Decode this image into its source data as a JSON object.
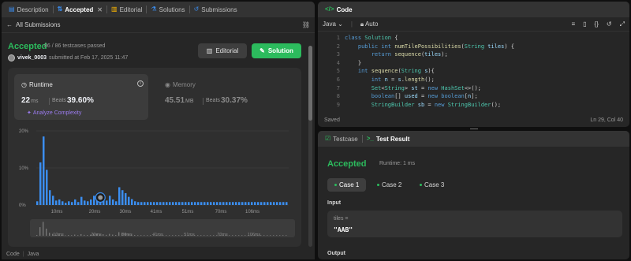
{
  "left_tabs": {
    "description": "Description",
    "accepted": "Accepted",
    "editorial": "Editorial",
    "solutions": "Solutions",
    "submissions": "Submissions"
  },
  "submission": {
    "back_label": "All Submissions",
    "status": "Accepted",
    "testcases": "86 / 86 testcases passed",
    "username": "vivek_0003",
    "submitted_at": "submitted at Feb 17, 2025 11:47",
    "editorial_btn": "Editorial",
    "solution_btn": "Solution"
  },
  "runtime": {
    "label": "Runtime",
    "value": "22",
    "unit": "ms",
    "beats_label": "Beats",
    "beats": "39.60%",
    "analyze": "Analyze Complexity"
  },
  "memory": {
    "label": "Memory",
    "value": "45.51",
    "unit": "MB",
    "beats_label": "Beats",
    "beats": "30.37%"
  },
  "chart_data": {
    "type": "bar",
    "y_ticks": [
      "20%",
      "10%",
      "0%"
    ],
    "ylim": [
      0,
      20
    ],
    "x_ticks": [
      "10ms",
      "20ms",
      "30ms",
      "41ms",
      "51ms",
      "70ms",
      "106ms"
    ],
    "values": [
      1,
      11.5,
      18.5,
      9.5,
      4,
      2.5,
      1.2,
      1.5,
      1,
      0.6,
      1,
      0.8,
      1.5,
      0.8,
      2.2,
      1.2,
      1,
      1.5,
      2.5,
      2.2,
      1.6,
      2,
      1.2,
      2.5,
      1.5,
      1,
      4.8,
      4,
      3.2,
      2.2,
      1.6,
      1,
      0.8,
      0.8,
      0.8,
      0.8,
      0.8,
      0.8,
      0.8,
      0.8,
      0.8,
      0.8,
      0.8,
      0.8,
      0.8,
      0.8,
      0.8,
      0.8,
      0.8,
      0.8,
      0.8,
      0.8,
      0.8,
      0.8,
      0.8,
      0.8,
      0.8,
      0.8,
      0.8,
      0.8,
      0.8,
      0.8,
      0.8,
      0.8,
      0.8,
      0.8,
      0.8,
      0.8,
      0.8,
      0.8,
      0.8,
      0.8,
      0.8,
      0.8,
      0.8,
      0.8,
      0.8,
      0.8,
      0.8,
      0.8
    ],
    "highlight_index": 20,
    "colors": {
      "bar": "#3b8ef0",
      "mini_bar": "#777777"
    }
  },
  "code_panel": {
    "title": "Code",
    "language": "Java",
    "autosave": "Auto",
    "status": "Saved",
    "cursor": "Ln 29, Col 40",
    "lines": [
      {
        "n": "1",
        "html": "<span class='kw'>class</span> <span class='ty'>Solution</span> {"
      },
      {
        "n": "2",
        "html": "    <span class='kw'>public</span> <span class='kw'>int</span> <span class='fn'>numTilePossibilities</span>(<span class='ty'>String</span> <span class='vr'>tiles</span>) {"
      },
      {
        "n": "3",
        "html": "        <span class='kw'>return</span> <span class='fn'>sequence</span>(<span class='vr'>tiles</span>);"
      },
      {
        "n": "4",
        "html": "    }"
      },
      {
        "n": "5",
        "html": "    <span class='kw'>int</span> <span class='fn'>sequence</span>(<span class='ty'>String</span> <span class='vr'>s</span>){"
      },
      {
        "n": "6",
        "html": "        <span class='kw'>int</span> <span class='vr'>n</span> = <span class='vr'>s</span>.<span class='fn'>length</span>();"
      },
      {
        "n": "7",
        "html": "        <span class='ty'>Set</span>&lt;<span class='ty'>String</span>&gt; <span class='vr'>st</span> = <span class='kw'>new</span> <span class='ty'>HashSet</span>&lt;&gt;();"
      },
      {
        "n": "8",
        "html": "        <span class='kw'>boolean</span>[] <span class='vr'>used</span> = <span class='kw'>new</span> <span class='kw'>boolean</span>[<span class='vr'>n</span>];"
      },
      {
        "n": "9",
        "html": "        <span class='ty'>StringBuilder</span> <span class='vr'>sb</span> = <span class='kw'>new</span> <span class='ty'>StringBuilder</span>();"
      }
    ]
  },
  "result_panel": {
    "testcase_tab": "Testcase",
    "result_tab": "Test Result",
    "status": "Accepted",
    "runtime": "Runtime: 1 ms",
    "cases": [
      "Case 1",
      "Case 2",
      "Case 3"
    ],
    "input_label": "Input",
    "var_name": "tiles =",
    "var_value": "\"AAB\"",
    "output_label": "Output"
  },
  "bottom_status": {
    "code": "Code",
    "lang": "Java"
  }
}
